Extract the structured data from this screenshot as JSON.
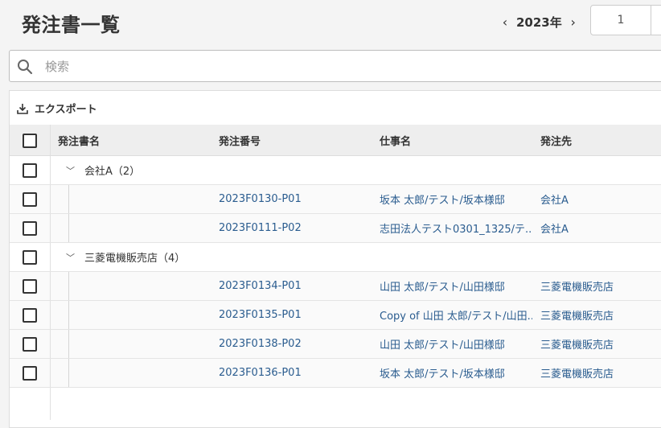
{
  "page": {
    "title": "発注書一覧"
  },
  "year_nav": {
    "prev_icon": "chevron-left-icon",
    "year": "2023年",
    "next_icon": "chevron-right-icon",
    "page_value": "1"
  },
  "search": {
    "placeholder": "検索",
    "value": ""
  },
  "toolbar": {
    "export_label": "エクスポート"
  },
  "table": {
    "columns": [
      "発注書名",
      "発注番号",
      "仕事名",
      "発注先"
    ],
    "groups": [
      {
        "label": "会社A（2）",
        "rows": [
          {
            "number": "2023F0130-P01",
            "job": "坂本 太郎/テスト/坂本様邸",
            "vendor": "会社A"
          },
          {
            "number": "2023F0111-P02",
            "job": "志田法人テスト0301_1325/テ...",
            "vendor": "会社A"
          }
        ]
      },
      {
        "label": "三菱電機販売店（4）",
        "rows": [
          {
            "number": "2023F0134-P01",
            "job": "山田 太郎/テスト/山田様邸",
            "vendor": "三菱電機販売店"
          },
          {
            "number": "2023F0135-P01",
            "job": "Copy of 山田 太郎/テスト/山田...",
            "vendor": "三菱電機販売店"
          },
          {
            "number": "2023F0138-P02",
            "job": "山田 太郎/テスト/山田様邸",
            "vendor": "三菱電機販売店"
          },
          {
            "number": "2023F0136-P01",
            "job": "坂本 太郎/テスト/坂本様邸",
            "vendor": "三菱電機販売店"
          }
        ]
      }
    ]
  }
}
